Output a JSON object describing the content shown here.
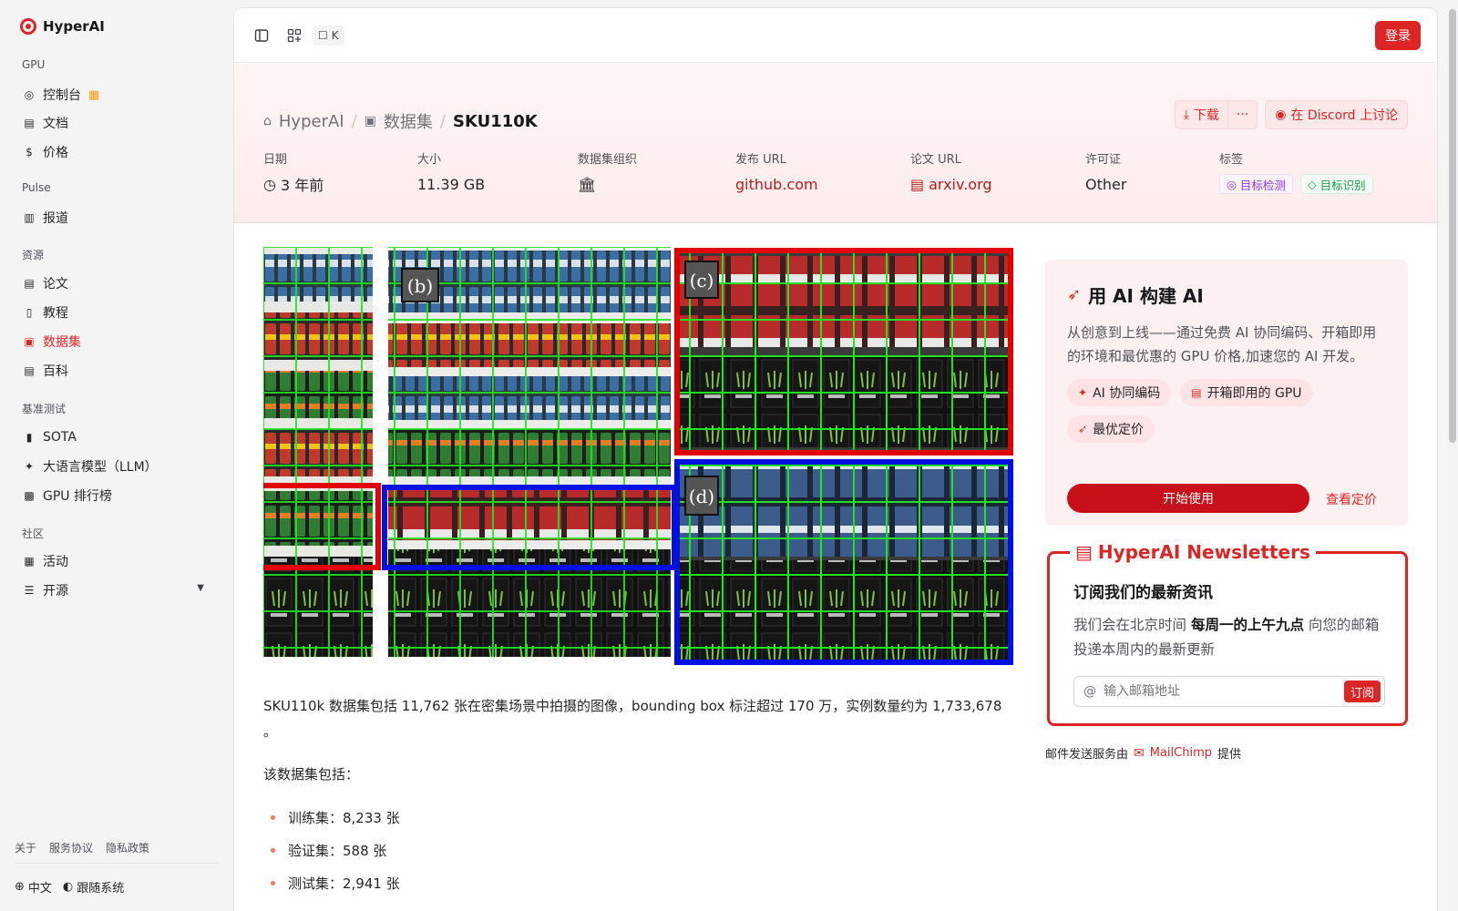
{
  "app": {
    "name": "HyperAI"
  },
  "sidebar": {
    "sections": [
      {
        "title": "GPU",
        "items": [
          {
            "label": "控制台",
            "icon": "gauge-icon",
            "badge": "gift-icon"
          },
          {
            "label": "文档",
            "icon": "doc-icon"
          },
          {
            "label": "价格",
            "icon": "dollar-icon"
          }
        ]
      },
      {
        "title": "Pulse",
        "items": [
          {
            "label": "报道",
            "icon": "newspaper-icon"
          }
        ]
      },
      {
        "title": "资源",
        "items": [
          {
            "label": "论文",
            "icon": "paper-icon"
          },
          {
            "label": "教程",
            "icon": "book-icon"
          },
          {
            "label": "数据集",
            "icon": "database-icon",
            "active": true
          },
          {
            "label": "百科",
            "icon": "wiki-icon"
          }
        ]
      },
      {
        "title": "基准测试",
        "items": [
          {
            "label": "SOTA",
            "icon": "bar-chart-icon"
          },
          {
            "label": "大语言模型（LLM）",
            "icon": "sparkle-icon"
          },
          {
            "label": "GPU 排行榜",
            "icon": "cpu-icon"
          }
        ]
      },
      {
        "title": "社区",
        "items": [
          {
            "label": "活动",
            "icon": "calendar-icon"
          },
          {
            "label": "开源",
            "icon": "list-icon",
            "expandable": true
          }
        ]
      }
    ],
    "footer_links": [
      "关于",
      "服务协议",
      "隐私政策"
    ],
    "language": "中文",
    "theme": "跟随系统"
  },
  "topbar": {
    "shortcut": "K",
    "login_label": "登录"
  },
  "header": {
    "breadcrumb": [
      "HyperAI",
      "数据集",
      "SKU110K"
    ],
    "download_label": "下载",
    "more_label": "···",
    "discord_label": "在 Discord 上讨论",
    "meta": [
      {
        "label": "日期",
        "value": "3 年前"
      },
      {
        "label": "大小",
        "value": "11.39 GB"
      },
      {
        "label": "数据集组织",
        "value": ""
      },
      {
        "label": "发布 URL",
        "value": "github.com"
      },
      {
        "label": "论文 URL",
        "value": "arxiv.org"
      },
      {
        "label": "许可证",
        "value": "Other"
      },
      {
        "label": "标签",
        "tags": [
          "目标检测",
          "目标识别"
        ]
      }
    ]
  },
  "content": {
    "image_panels": [
      "(b)",
      "(c)",
      "(d)"
    ],
    "description": "SKU110k 数据集包括 11,762 张在密集场景中拍摄的图像，bounding box 标注超过 170 万，实例数量约为 1,733,678 。",
    "subtitle": "该数据集包括：",
    "bullets": [
      "训练集：8,233 张",
      "验证集：588 张",
      "测试集：2,941 张"
    ]
  },
  "ai_card": {
    "title": "用 AI 构建 AI",
    "description": "从创意到上线——通过免费 AI 协同编码、开箱即用的环境和最优惠的 GPU 价格,加速您的 AI 开发。",
    "pills": [
      "AI 协同编码",
      "开箱即用的 GPU",
      "最优定价"
    ],
    "start_label": "开始使用",
    "pricing_label": "查看定价"
  },
  "newsletter": {
    "legend": "HyperAI Newsletters",
    "heading": "订阅我们的最新资讯",
    "text_before": "我们会在北京时间 ",
    "text_bold": "每周一的上午九点",
    "text_after": " 向您的邮箱投递本周内的最新更新",
    "email_placeholder": "输入邮箱地址",
    "subscribe_label": "订阅"
  },
  "mailchimp": {
    "prefix": "邮件发送服务由",
    "brand": "MailChimp",
    "suffix": "提供"
  },
  "colors": {
    "accent": "#dc2626",
    "sidebar_bg": "#f4f4f5"
  }
}
